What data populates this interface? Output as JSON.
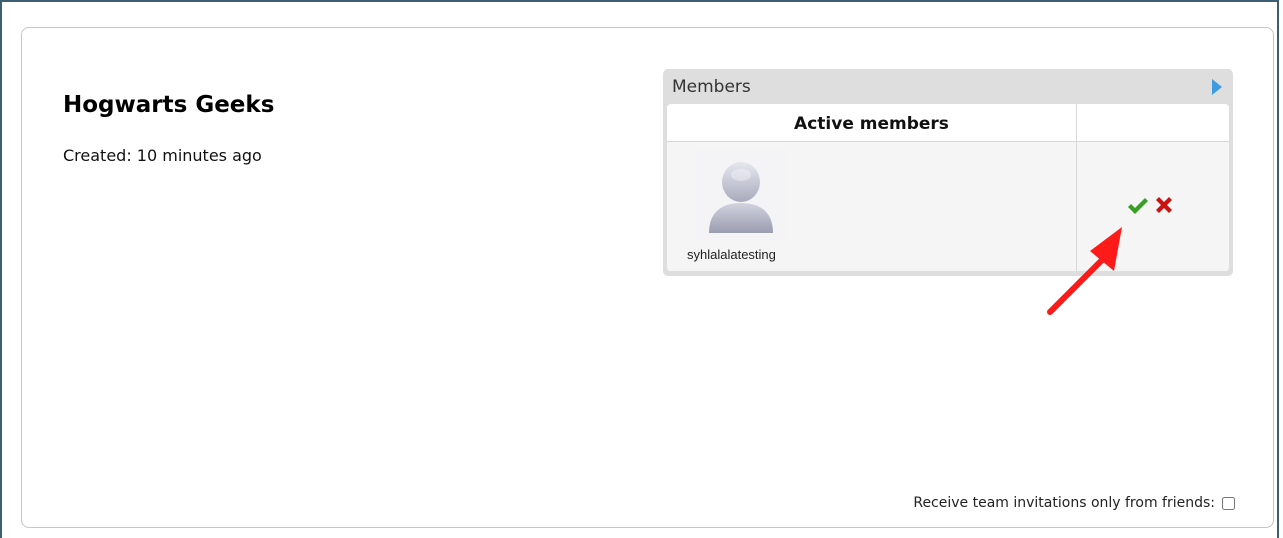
{
  "team": {
    "name": "Hogwarts Geeks",
    "created": "Created: 10 minutes ago"
  },
  "members_panel": {
    "title": "Members",
    "header_active": "Active members",
    "rows": [
      {
        "username": "syhlalalatesting",
        "avatar": "default-user-avatar",
        "actions": [
          "accept-icon",
          "reject-icon"
        ]
      }
    ]
  },
  "settings": {
    "friends_only_label": "Receive team invitations only from friends:",
    "friends_only_checked": false
  },
  "colors": {
    "frame": "#3e5f73",
    "accent_arrow": "#3f9be0",
    "accept": "#37a021",
    "reject": "#cc1111",
    "annotation": "#ff1a1a"
  }
}
